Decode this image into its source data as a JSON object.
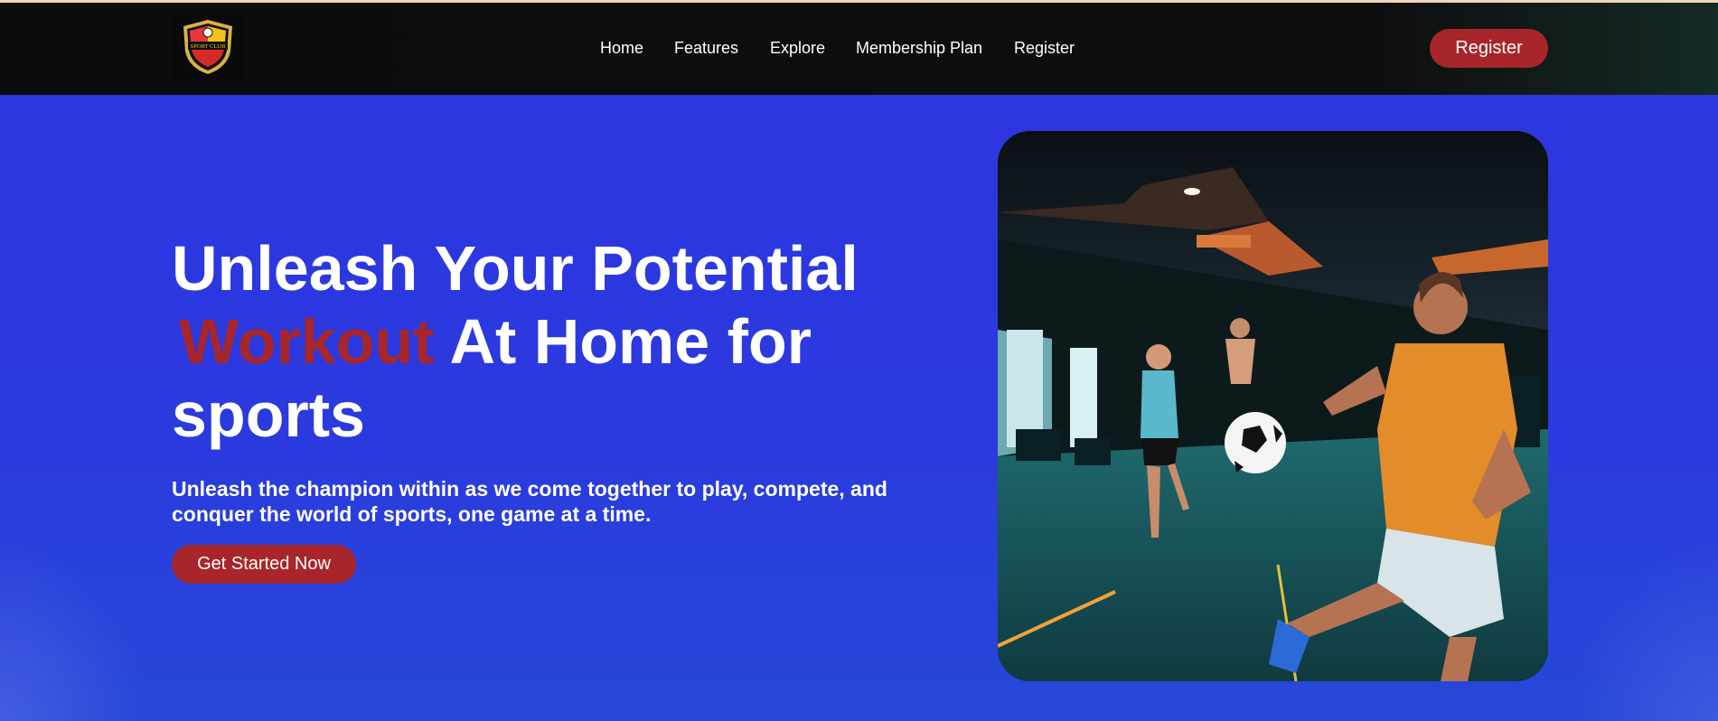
{
  "logo": {
    "text": "SPORT CLUB",
    "icon": "sport-club-shield-logo"
  },
  "nav": {
    "links": [
      "Home",
      "Features",
      "Explore",
      "Membership Plan",
      "Register"
    ],
    "register_button": "Register"
  },
  "hero": {
    "title_line1": "Unleash Your Potential",
    "title_accent": "Workout",
    "title_rest": "At Home for sports",
    "subtitle": "Unleash the champion within as we come together to play, compete, and conquer the world of sports, one game at a time.",
    "cta_label": "Get Started Now",
    "image_icon": "soccer-gym-photo"
  },
  "colors": {
    "accent": "#a8262a",
    "nav_bg": "#0e0e0e",
    "hero_bg": "#2c35e0",
    "text": "#ffffff"
  }
}
